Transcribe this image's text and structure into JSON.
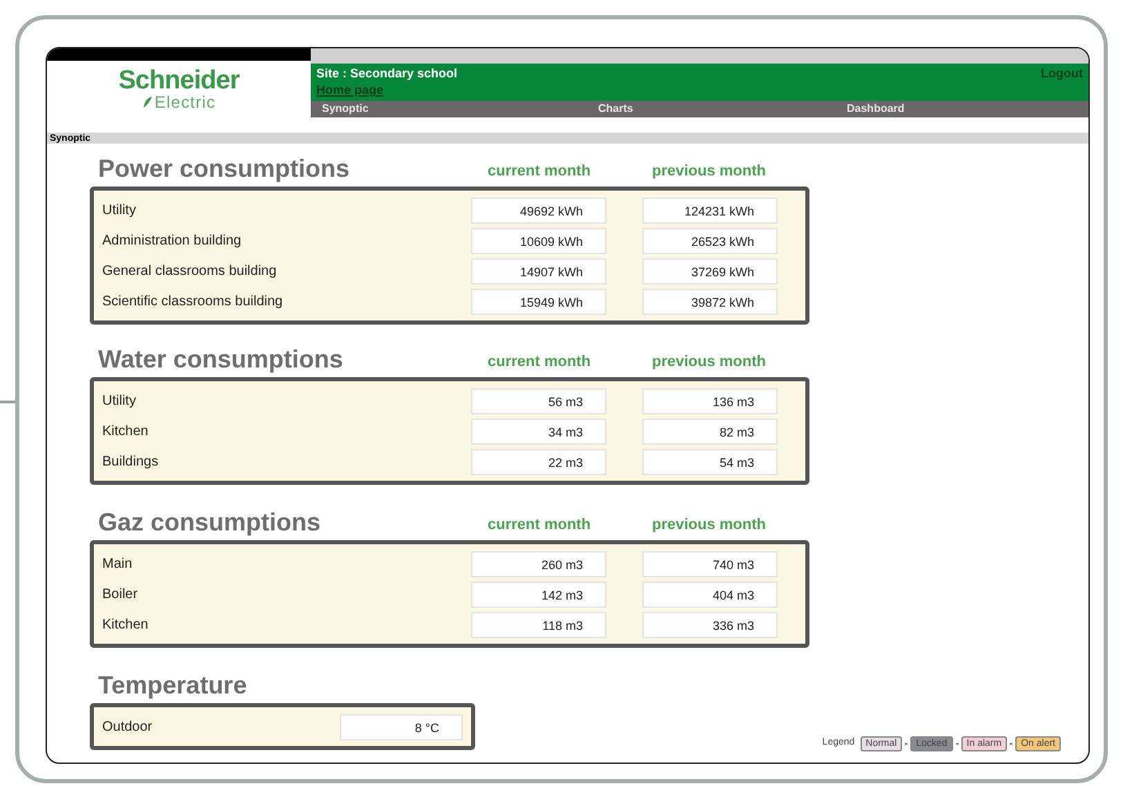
{
  "logo": {
    "name": "Schneider",
    "sub": "Electric"
  },
  "header": {
    "site": "Site :  Secondary school",
    "home_link": "Home page",
    "logout": "Logout",
    "nav": [
      {
        "label": "Synoptic"
      },
      {
        "label": "Charts"
      },
      {
        "label": "Dashboard"
      }
    ]
  },
  "breadcrumb": "Synoptic",
  "sections": [
    {
      "title": "Power consumptions",
      "columns": [
        "current month",
        "previous month"
      ],
      "rows": [
        {
          "label": "Utility",
          "values": [
            "49692 kWh",
            "124231 kWh"
          ]
        },
        {
          "label": "Administration building",
          "values": [
            "10609 kWh",
            "26523 kWh"
          ]
        },
        {
          "label": "General classrooms building",
          "values": [
            "14907 kWh",
            "37269 kWh"
          ]
        },
        {
          "label": "Scientific classrooms building",
          "values": [
            "15949 kWh",
            "39872 kWh"
          ]
        }
      ]
    },
    {
      "title": "Water consumptions",
      "columns": [
        "current month",
        "previous month"
      ],
      "rows": [
        {
          "label": "Utility",
          "values": [
            "56 m3",
            "136 m3"
          ]
        },
        {
          "label": "Kitchen",
          "values": [
            "34 m3",
            "82 m3"
          ]
        },
        {
          "label": "Buildings",
          "values": [
            "22 m3",
            "54 m3"
          ]
        }
      ]
    },
    {
      "title": "Gaz consumptions",
      "columns": [
        "current month",
        "previous month"
      ],
      "rows": [
        {
          "label": "Main",
          "values": [
            "260 m3",
            "740 m3"
          ]
        },
        {
          "label": "Boiler",
          "values": [
            "142 m3",
            "404 m3"
          ]
        },
        {
          "label": "Kitchen",
          "values": [
            "118 m3",
            "336 m3"
          ]
        }
      ]
    },
    {
      "title": "Temperature",
      "rows": [
        {
          "label": "Outdoor",
          "values": [
            "8 °C"
          ]
        }
      ]
    }
  ],
  "legend": {
    "label": "Legend",
    "items": [
      {
        "label": "Normal",
        "color": "#e8dde3"
      },
      {
        "label": "Locked",
        "color": "#8a8a92"
      },
      {
        "label": "In alarm",
        "color": "#f3cfd8"
      },
      {
        "label": "On alert",
        "color": "#f2c77a"
      }
    ]
  }
}
